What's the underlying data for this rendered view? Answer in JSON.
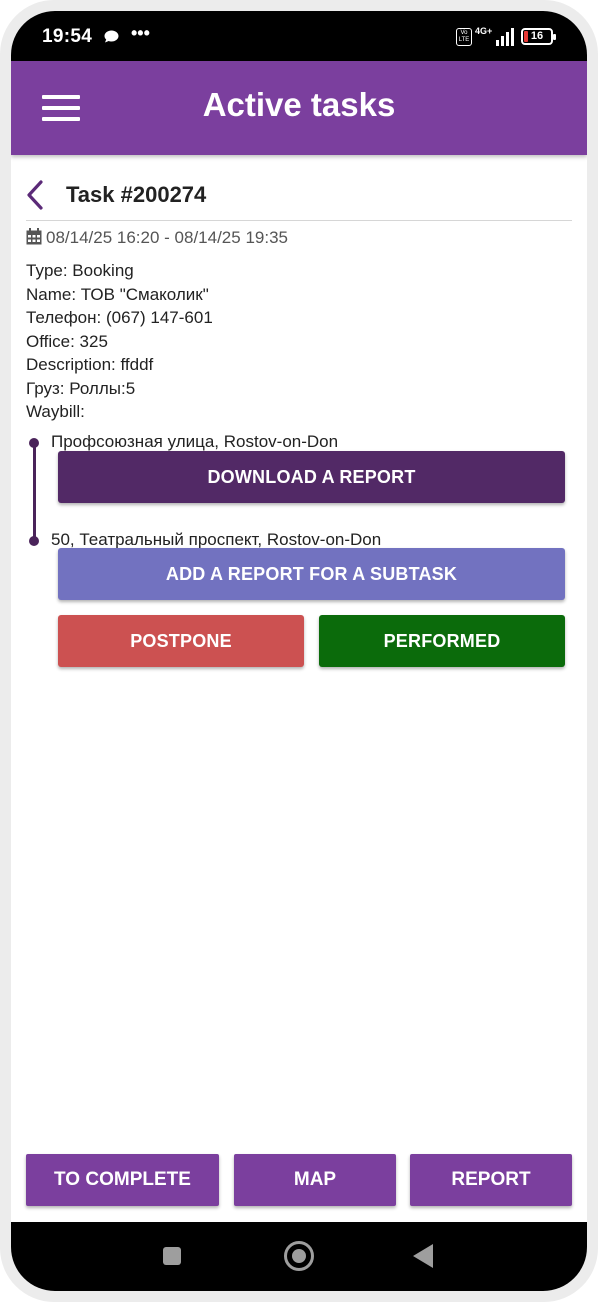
{
  "status_bar": {
    "time": "19:54",
    "dots": "•••",
    "volte": "Vo LTE",
    "network": "4G+",
    "battery": "16"
  },
  "app_bar": {
    "title": "Active tasks"
  },
  "task": {
    "title": "Task #200274",
    "date_range": "08/14/25 16:20 - 08/14/25 19:35",
    "type": "Type: Booking",
    "name": "Name: ТОВ \"Смаколик\"",
    "phone": "Телефон: (067) 147-601",
    "office": "Office: 325",
    "description": "Description: ffddf",
    "cargo": "Груз: Роллы:5",
    "waybill": "Waybill:"
  },
  "route": {
    "start_address": "Профсоюзная улица, Rostov-on-Don",
    "end_address": "50, Театральный проспект, Rostov-on-Don"
  },
  "buttons": {
    "download_report": "DOWNLOAD A REPORT",
    "add_report": "ADD A REPORT FOR A SUBTASK",
    "postpone": "POSTPONE",
    "performed": "PERFORMED"
  },
  "bottom_bar": {
    "to_complete": "TO COMPLETE",
    "map": "MAP",
    "report": "REPORT"
  },
  "colors": {
    "primary": "#7b3f9e",
    "download": "#522966",
    "add_report": "#7272c0",
    "postpone": "#cc5151",
    "performed": "#0b6b0b"
  },
  "icons": {
    "menu": "hamburger-menu-icon",
    "back": "chevron-left-icon",
    "calendar": "calendar-icon",
    "message": "message-bubble-icon",
    "nav_recents": "square-icon",
    "nav_home": "circle-icon",
    "nav_back": "triangle-back-icon"
  }
}
